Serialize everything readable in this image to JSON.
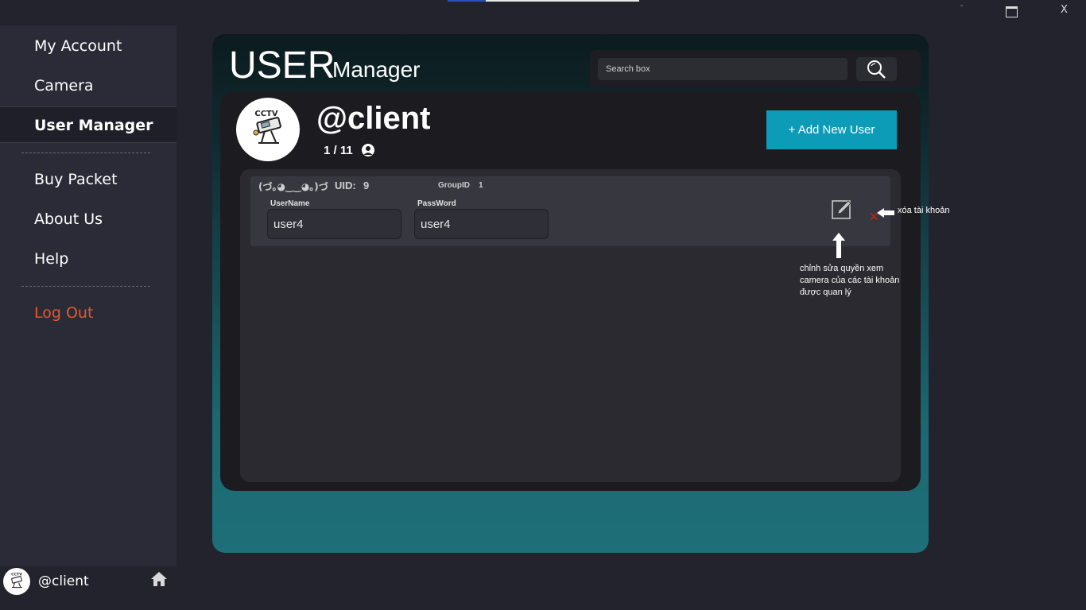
{
  "window": {
    "minimize_label": "-",
    "close_label": "X"
  },
  "sidebar": {
    "items": [
      {
        "label": "My Account"
      },
      {
        "label": "Camera"
      },
      {
        "label": "User Manager"
      },
      {
        "label": "Buy Packet"
      },
      {
        "label": "About Us"
      },
      {
        "label": "Help"
      }
    ],
    "logout_label": "Log Out",
    "footer_username": "@client",
    "active_item": "User Manager"
  },
  "header": {
    "title": "USER",
    "subtitle": "Manager",
    "search_placeholder": "Search box"
  },
  "profile": {
    "name": "@client",
    "user_count": "1 / 11",
    "add_button_label": "+ Add New User"
  },
  "users": [
    {
      "kaomoji": "(づ｡◕‿‿◕｡)づ",
      "uid_label": "UID:",
      "uid": "9",
      "group_label": "GroupID",
      "group_id": "1",
      "username_label": "UserName",
      "username": "user4",
      "password_label": "PassWord",
      "password": "user4"
    }
  ],
  "annotations": {
    "delete_note": "xóa tài khoản",
    "edit_note": "chỉnh sửa quyền xem camera của các tài khoản được quan lý"
  },
  "colors": {
    "accent": "#0d9cb8",
    "logout": "#e15a2b",
    "delete": "#d21c1c",
    "sidebar_bg": "#2b2b37",
    "panel_teal": "#1e6f79"
  },
  "icons": [
    "search-icon",
    "edit-icon",
    "delete-icon",
    "home-icon",
    "person-icon",
    "cctv-logo"
  ]
}
